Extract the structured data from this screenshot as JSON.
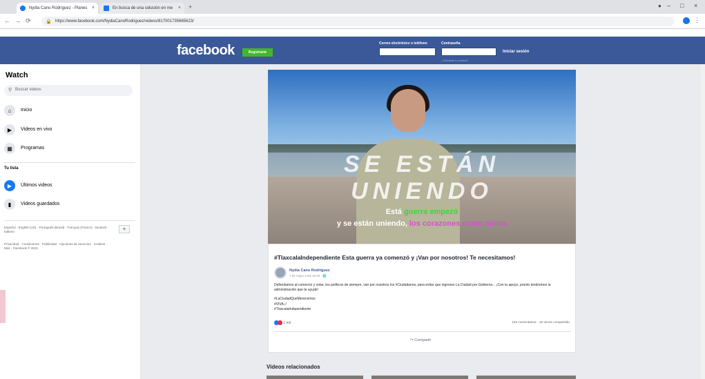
{
  "browser": {
    "tab_active_title": "Nydia Cano Rodríguez - Planes",
    "tab_inactive_title": "En busca de una solución en me",
    "url": "https://www.facebook.com/NydiaCanoRodriguez/videos/817001735665623/",
    "new_tab_symbol": "+",
    "close_symbol": "×",
    "minimize_symbol": "–",
    "maximize_symbol": "□",
    "window_close_symbol": "×"
  },
  "fb_header": {
    "logo": "facebook",
    "signup": "Registrarte",
    "email_label": "Correo electrónico o teléfono",
    "password_label": "Contraseña",
    "login": "Iniciar sesión",
    "forgot": "¿Olvidaste tu cuenta?",
    "brand_color": "#3b5998"
  },
  "sidebar": {
    "title": "Watch",
    "search_placeholder": "Buscar videos",
    "items": [
      {
        "label": "Inicio",
        "icon": "home-icon"
      },
      {
        "label": "Videos en vivo",
        "icon": "live-icon"
      },
      {
        "label": "Programas",
        "icon": "shows-icon"
      }
    ],
    "section": "Tu lista",
    "list_items": [
      {
        "label": "Últimos videos",
        "icon": "play-icon"
      },
      {
        "label": "Videos guardados",
        "icon": "bookmark-icon"
      }
    ],
    "languages": "Español · English (US) · Português (Brasil) · Français (France) · Deutsch · Italiano",
    "add_language": "+",
    "footer": "Privacidad · Condiciones · Publicidad · Opciones de anuncios · Cookies · Más · Facebook © 2021"
  },
  "video": {
    "overlay_big": "SE ESTÁN UNIENDO",
    "caption_line1_a": "Está",
    "caption_line1_b": "guerra empezó",
    "caption_line2_a": "y se están uniendo,",
    "caption_line2_b": "los corazones como nunca"
  },
  "post": {
    "title": "#TlaxcalaIndependiente Esta guerra ya comenzó y ¡Van por nosotros! Te necesitamos!",
    "author": "Nydia Cano Rodríguez",
    "time": "7 de mayo a las 10:30 · 🌐",
    "body": "Defendamos al comercio y votar, los políticos de siempre, van por nosotros los #Ciudadanos, para evitar que ingreses La Ciudad por Gobierno... ¡Con tu apoyo, pronto tendremos la administración que te ayude!",
    "hashtag1": "#LaCiudadQueMerecemos",
    "hashtag2": "#VIVA ¡!",
    "hashtag3": "#TlaxcalaIndependiente",
    "reactions_count": "1 mil",
    "stats": "125 comentarios · 18 veces compartido",
    "share": "Compartir"
  },
  "related": {
    "title": "Videos relacionados"
  }
}
